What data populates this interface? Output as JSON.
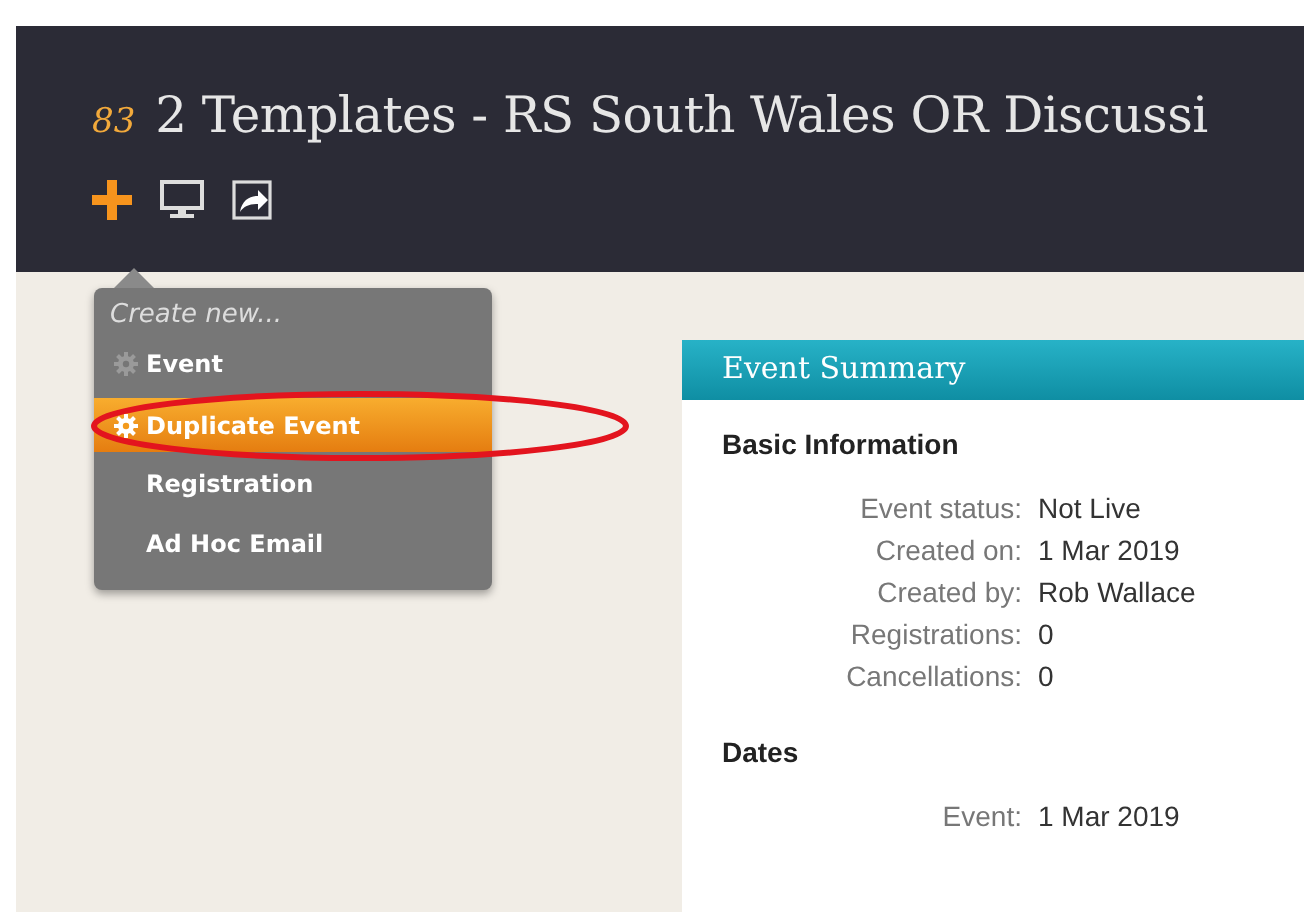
{
  "header": {
    "count": "83",
    "title": "2 Templates - RS South Wales OR Discussi",
    "toolbar": [
      {
        "kind": "plus"
      },
      {
        "kind": "monitor"
      },
      {
        "kind": "share"
      }
    ]
  },
  "menu": {
    "heading": "Create new...",
    "items": [
      {
        "label": "Event",
        "icon": true,
        "selected": false
      },
      {
        "label": "Duplicate Event",
        "icon": true,
        "selected": true
      },
      {
        "label": "Registration",
        "icon": false,
        "selected": false
      },
      {
        "label": "Ad Hoc Email",
        "icon": false,
        "selected": false
      }
    ]
  },
  "annotations": [
    {
      "kind": "ellipse"
    }
  ],
  "panel": {
    "title": "Event Summary",
    "sections": [
      {
        "heading": "Basic Information",
        "rows": [
          {
            "label": "Event status:",
            "value": "Not Live"
          },
          {
            "label": "Created on:",
            "value": "1 Mar 2019"
          },
          {
            "label": "Created by:",
            "value": "Rob Wallace"
          },
          {
            "label": "Registrations:",
            "value": "0"
          },
          {
            "label": "Cancellations:",
            "value": "0"
          }
        ]
      },
      {
        "heading": "Dates",
        "rows": [
          {
            "label": "Event:",
            "value": "1 Mar 2019"
          }
        ]
      }
    ]
  }
}
